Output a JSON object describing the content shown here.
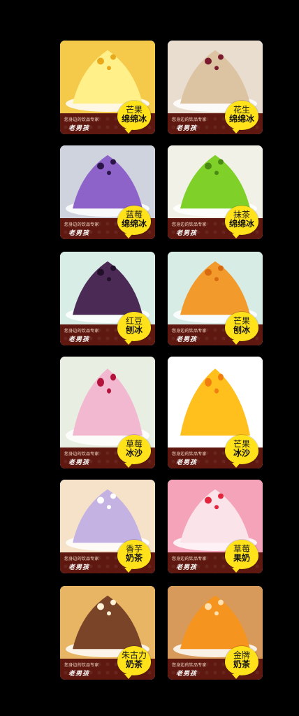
{
  "tagline": "您身边的饮品专家",
  "brand": "老男孩",
  "cards": [
    {
      "flavor": "芒果",
      "kind": "绵绵冰",
      "bg": "#f5c94a",
      "food": "#fff08a",
      "accent": "#e9a91b"
    },
    {
      "flavor": "花生",
      "kind": "绵绵冰",
      "bg": "#e9ddd0",
      "food": "#dcc3a2",
      "accent": "#7a1a2c"
    },
    {
      "flavor": "蓝莓",
      "kind": "绵绵冰",
      "bg": "#cfd3dd",
      "food": "#8e63c9",
      "accent": "#2a1448"
    },
    {
      "flavor": "抹茶",
      "kind": "绵绵冰",
      "bg": "#f1f1e8",
      "food": "#7fd12a",
      "accent": "#4a8a12"
    },
    {
      "flavor": "红豆",
      "kind": "刨冰",
      "bg": "#d7ede6",
      "food": "#4b2a55",
      "accent": "#22102a"
    },
    {
      "flavor": "芒果",
      "kind": "刨冰",
      "bg": "#d8ece6",
      "food": "#f39a2c",
      "accent": "#d86a10"
    },
    {
      "flavor": "草莓",
      "kind": "冰沙",
      "bg": "#e8eee2",
      "food": "#f2b8d0",
      "accent": "#b3123a"
    },
    {
      "flavor": "芒果",
      "kind": "冰沙",
      "bg": "#ffffff",
      "food": "#ffc01e",
      "accent": "#f07f10"
    },
    {
      "flavor": "香芋",
      "kind": "奶茶",
      "bg": "#f6e2c9",
      "food": "#c3b2e2",
      "accent": "#ffffff"
    },
    {
      "flavor": "草莓",
      "kind": "果奶",
      "bg": "#f4a3b8",
      "food": "#fbe3ea",
      "accent": "#e3243c"
    },
    {
      "flavor": "朱古力",
      "kind": "奶茶",
      "bg": "#e8b564",
      "food": "#7a4428",
      "accent": "#fff2d6"
    },
    {
      "flavor": "金牌",
      "kind": "奶茶",
      "bg": "#d79a5a",
      "food": "#f5941e",
      "accent": "#ffe0b0"
    }
  ]
}
